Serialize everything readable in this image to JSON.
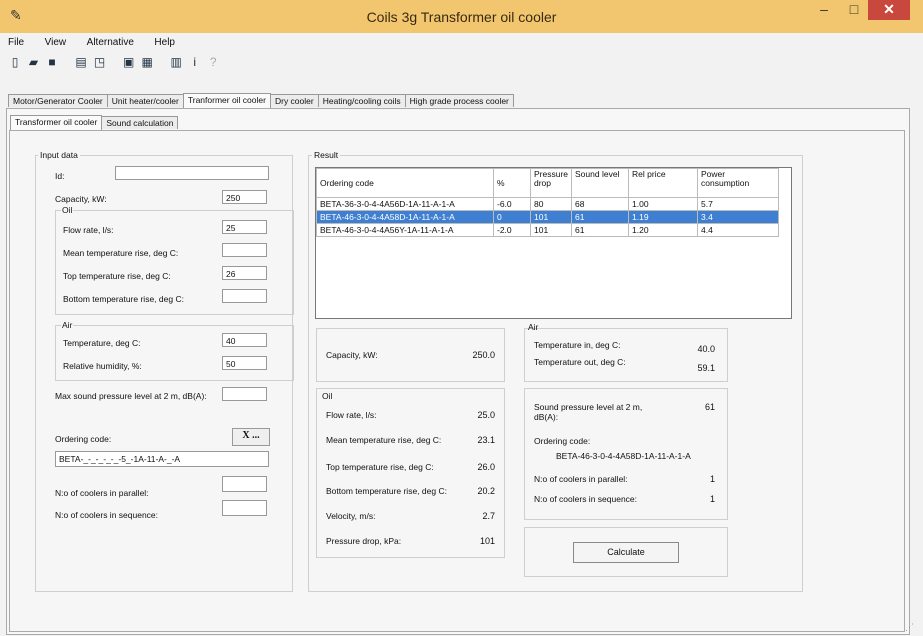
{
  "window": {
    "title": "Coils 3g Transformer oil cooler",
    "minimize": "–",
    "maximize": "□",
    "close": "✕"
  },
  "menu": [
    "File",
    "View",
    "Alternative",
    "Help"
  ],
  "tabs_main": [
    "Motor/Generator Cooler",
    "Unit heater/cooler",
    "Tranformer oil cooler",
    "Dry cooler",
    "Heating/cooling coils",
    "High grade process cooler"
  ],
  "tabs_sub": [
    "Transformer oil cooler",
    "Sound calculation"
  ],
  "input": {
    "title": "Input data",
    "id_label": "Id:",
    "id_value": "",
    "capacity_label": "Capacity, kW:",
    "capacity_value": "250",
    "oil_title": "Oil",
    "flow_label": "Flow rate, l/s:",
    "flow_value": "25",
    "mean_label": "Mean temperature rise, deg C:",
    "mean_value": "",
    "top_label": "Top temperature rise, deg C:",
    "top_value": "26",
    "bottom_label": "Bottom temperature rise, deg C:",
    "bottom_value": "",
    "air_title": "Air",
    "temp_label": "Temperature, deg C:",
    "temp_value": "40",
    "rh_label": "Relative humidity, %:",
    "rh_value": "50",
    "max_sound_label": "Max sound pressure level at 2 m, dB(A):",
    "max_sound_value": "",
    "ordering_label": "Ordering code:",
    "x_button": "X ...",
    "ordering_value": "BETA-_-_-_-_-_-5_-1A-11-A-_-A",
    "parallel_label": "N:o of coolers in parallel:",
    "parallel_value": "",
    "sequence_label": "N:o of coolers in sequence:",
    "sequence_value": ""
  },
  "result": {
    "title": "Result",
    "columns": [
      "Ordering code",
      "%",
      "Pressure drop",
      "Sound level",
      "Rel price",
      "Power consumption"
    ],
    "rows": [
      [
        "BETA-36-3-0-4-4A56D-1A-11-A-1-A",
        "-6.0",
        "80",
        "68",
        "1.00",
        "5.7"
      ],
      [
        "BETA-46-3-0-4-4A58D-1A-11-A-1-A",
        "0",
        "101",
        "61",
        "1.19",
        "3.4"
      ],
      [
        "BETA-46-3-0-4-4A56Y-1A-11-A-1-A",
        "-2.0",
        "101",
        "61",
        "1.20",
        "4.4"
      ]
    ],
    "selected_row": 1
  },
  "summary": {
    "capacity_label": "Capacity, kW:",
    "capacity_value": "250.0",
    "oil_title": "Oil",
    "flow_label": "Flow rate, l/s:",
    "flow_value": "25.0",
    "mean_label": "Mean temperature rise, deg C:",
    "mean_value": "23.1",
    "top_label": "Top temperature rise, deg C:",
    "top_value": "26.0",
    "bottom_label": "Bottom temperature rise, deg C:",
    "bottom_value": "20.2",
    "velocity_label": "Velocity, m/s:",
    "velocity_value": "2.7",
    "pdrop_label": "Pressure drop, kPa:",
    "pdrop_value": "101",
    "air_title": "Air",
    "tin_label": "Temperature in, deg C:",
    "tin_value": "40.0",
    "tout_label": "Temperature out, deg C:",
    "tout_value": "59.1",
    "sound_label": "Sound pressure level at 2 m, dB(A):",
    "sound_value": "61",
    "ordering_label": "Ordering code:",
    "ordering_value": "BETA-46-3-0-4-4A58D-1A-11-A-1-A",
    "parallel_label": "N:o of coolers in parallel:",
    "parallel_value": "1",
    "sequence_label": "N:o of coolers in sequence:",
    "sequence_value": "1",
    "calculate": "Calculate"
  }
}
